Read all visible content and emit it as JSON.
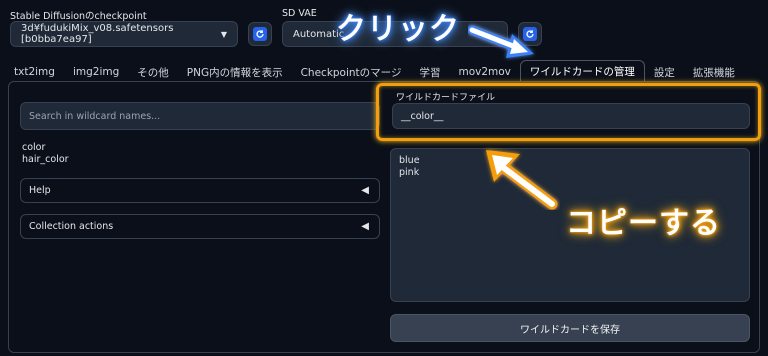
{
  "checkpoint": {
    "label": "Stable Diffusionのcheckpoint",
    "value": "3d¥fudukiMix_v08.safetensors [b0bba7ea97]"
  },
  "vae": {
    "label": "SD VAE",
    "value": "Automatic"
  },
  "tabs": [
    {
      "label": "txt2img"
    },
    {
      "label": "img2img"
    },
    {
      "label": "その他"
    },
    {
      "label": "PNG内の情報を表示"
    },
    {
      "label": "Checkpointのマージ"
    },
    {
      "label": "学習"
    },
    {
      "label": "mov2mov"
    },
    {
      "label": "ワイルドカードの管理",
      "active": true
    },
    {
      "label": "設定"
    },
    {
      "label": "拡張機能"
    }
  ],
  "left": {
    "search_placeholder": "Search in wildcard names...",
    "wildcards": [
      "color",
      "hair_color"
    ],
    "accordions": [
      {
        "label": "Help"
      },
      {
        "label": "Collection actions"
      }
    ]
  },
  "right": {
    "file_label": "ワイルドカードファイル",
    "file_value": "__color__",
    "content_lines": [
      "blue",
      "pink"
    ],
    "save_button": "ワイルドカードを保存"
  },
  "annotations": {
    "click": "クリック",
    "copy": "コピーする",
    "blue_color": "#3b82f6",
    "orange_color": "#f59e0b"
  }
}
